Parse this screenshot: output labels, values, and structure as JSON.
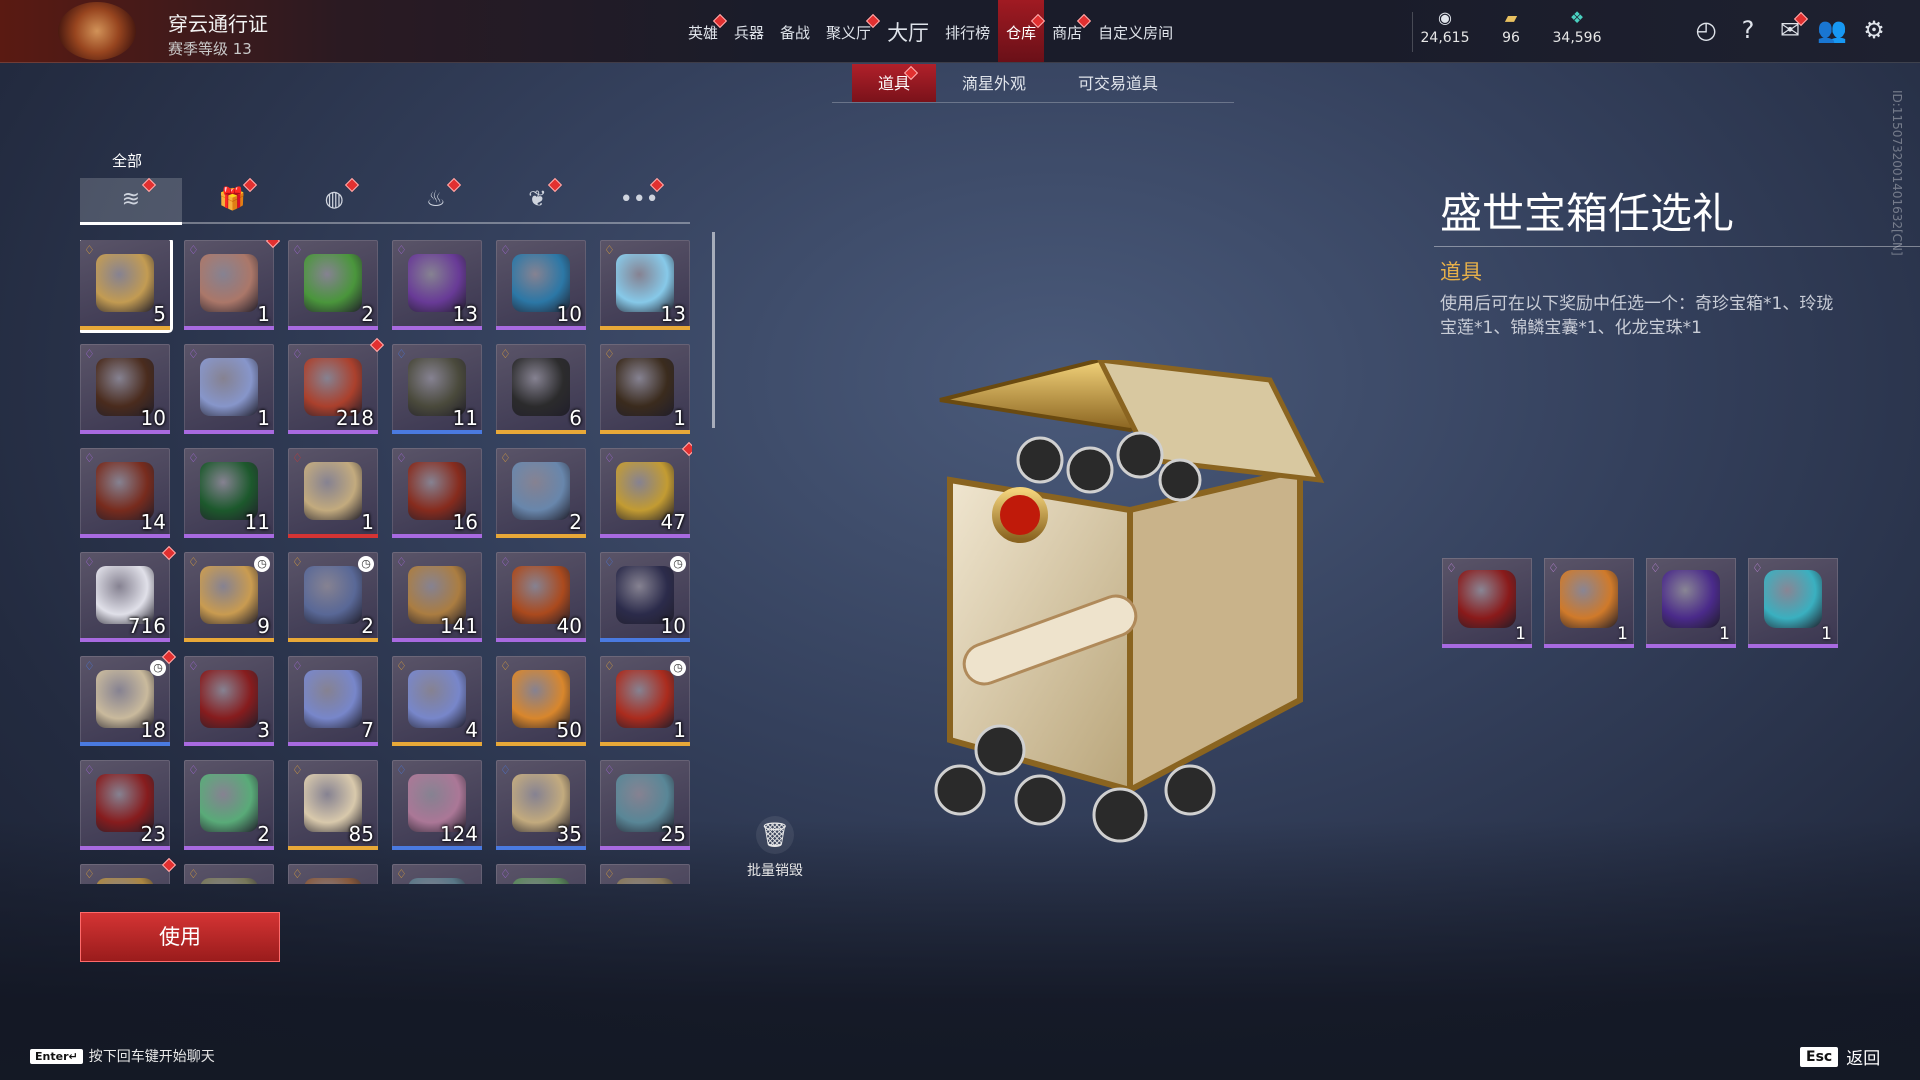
{
  "header": {
    "pass_title": "穿云通行证",
    "pass_level": "赛季等级 13",
    "nav": [
      {
        "label": "英雄",
        "dot": true
      },
      {
        "label": "兵器",
        "dot": false
      },
      {
        "label": "备战",
        "dot": false
      },
      {
        "label": "聚义厅",
        "dot": true
      },
      {
        "label": "大厅",
        "dot": false,
        "big": true
      },
      {
        "label": "排行榜",
        "dot": false
      },
      {
        "label": "仓库",
        "dot": true,
        "active": true
      },
      {
        "label": "商店",
        "dot": true
      },
      {
        "label": "自定义房间",
        "dot": false
      }
    ],
    "currencies": [
      {
        "icon": "mask-coin-icon",
        "value": "24,615"
      },
      {
        "icon": "ticket-icon",
        "value": "96"
      },
      {
        "icon": "feather-gem-icon",
        "value": "34,596"
      }
    ],
    "icons": [
      "timer-icon",
      "help-icon",
      "mail-icon",
      "friends-icon",
      "settings-icon"
    ]
  },
  "subtabs": [
    {
      "label": "道具",
      "active": true,
      "dot": true
    },
    {
      "label": "滴星外观",
      "active": false,
      "dot": false
    },
    {
      "label": "可交易道具",
      "active": false,
      "dot": false
    }
  ],
  "filters": {
    "all_label": "全部",
    "items": [
      {
        "icon": "layers-icon",
        "active": true
      },
      {
        "icon": "gift-icon",
        "active": false
      },
      {
        "icon": "pouch-icon",
        "active": false
      },
      {
        "icon": "flame-icon",
        "active": false
      },
      {
        "icon": "wreath-icon",
        "active": false
      },
      {
        "icon": "more-icon",
        "active": false
      }
    ]
  },
  "colors": {
    "purple": "#a86ae0",
    "gold": "#e8a838",
    "blue": "#4a7ae0",
    "red": "#d43434",
    "accent": "#b0202a"
  },
  "items": [
    {
      "qty": "5",
      "rarity": "gold",
      "art": "#c9a052",
      "selected": true
    },
    {
      "qty": "1",
      "rarity": "purple",
      "art": "#b07a6a",
      "dot": true
    },
    {
      "qty": "2",
      "rarity": "purple",
      "art": "#4a9a3a"
    },
    {
      "qty": "13",
      "rarity": "purple",
      "art": "#6a3a9a"
    },
    {
      "qty": "10",
      "rarity": "purple",
      "art": "#2a7aaa"
    },
    {
      "qty": "13",
      "rarity": "gold",
      "art": "#8ad0f0"
    },
    {
      "qty": "10",
      "rarity": "purple",
      "art": "#4a2a1a"
    },
    {
      "qty": "1",
      "rarity": "purple",
      "art": "#8a9ad0"
    },
    {
      "qty": "218",
      "rarity": "purple",
      "art": "#b0402a",
      "dot": true
    },
    {
      "qty": "11",
      "rarity": "blue",
      "art": "#4a4a3a"
    },
    {
      "qty": "6",
      "rarity": "gold",
      "art": "#2a2a2a"
    },
    {
      "qty": "1",
      "rarity": "gold",
      "art": "#3a2a1a"
    },
    {
      "qty": "14",
      "rarity": "purple",
      "art": "#7a2a1a"
    },
    {
      "qty": "11",
      "rarity": "purple",
      "art": "#1a5a2a"
    },
    {
      "qty": "1",
      "rarity": "red",
      "art": "#c9b080"
    },
    {
      "qty": "16",
      "rarity": "purple",
      "art": "#8a2a1a"
    },
    {
      "qty": "2",
      "rarity": "gold",
      "art": "#6a8ab0"
    },
    {
      "qty": "47",
      "rarity": "purple",
      "art": "#c9a030",
      "dot": true
    },
    {
      "qty": "716",
      "rarity": "purple",
      "art": "#e8e8f0",
      "dot": true
    },
    {
      "qty": "9",
      "rarity": "gold",
      "art": "#d0a050",
      "clock": true
    },
    {
      "qty": "2",
      "rarity": "gold",
      "art": "#5a6a9a",
      "clock": true
    },
    {
      "qty": "141",
      "rarity": "purple",
      "art": "#b08040"
    },
    {
      "qty": "40",
      "rarity": "purple",
      "art": "#b04a1a"
    },
    {
      "qty": "10",
      "rarity": "blue",
      "art": "#2a2a4a",
      "clock": true
    },
    {
      "qty": "18",
      "rarity": "blue",
      "art": "#d0c0a0",
      "clock": true,
      "dot": true
    },
    {
      "qty": "3",
      "rarity": "purple",
      "art": "#8a1a1a"
    },
    {
      "qty": "7",
      "rarity": "purple",
      "art": "#7a8ad0"
    },
    {
      "qty": "4",
      "rarity": "gold",
      "art": "#7a8ad0"
    },
    {
      "qty": "50",
      "rarity": "gold",
      "art": "#e08a2a"
    },
    {
      "qty": "1",
      "rarity": "gold",
      "art": "#b02a1a",
      "clock": true
    },
    {
      "qty": "23",
      "rarity": "purple",
      "art": "#8a1a1a"
    },
    {
      "qty": "2",
      "rarity": "purple",
      "art": "#5ab07a"
    },
    {
      "qty": "85",
      "rarity": "gold",
      "art": "#e0d0b0"
    },
    {
      "qty": "124",
      "rarity": "blue",
      "art": "#b07a9a"
    },
    {
      "qty": "35",
      "rarity": "blue",
      "art": "#c9b080"
    },
    {
      "qty": "25",
      "rarity": "purple",
      "art": "#5a8a9a"
    },
    {
      "qty": "",
      "rarity": "gold",
      "art": "#b08a40",
      "dot": true
    },
    {
      "qty": "",
      "rarity": "gold",
      "art": "#7a7a5a"
    },
    {
      "qty": "",
      "rarity": "gold",
      "art": "#8a5a3a"
    },
    {
      "qty": "",
      "rarity": "gold",
      "art": "#5a7a8a"
    },
    {
      "qty": "",
      "rarity": "purple",
      "art": "#5a8a5a"
    },
    {
      "qty": "",
      "rarity": "gold",
      "art": "#8a7a5a"
    }
  ],
  "actions": {
    "use_label": "使用",
    "destroy_label": "批量销毁"
  },
  "detail": {
    "title": "盛世宝箱任选礼",
    "type": "道具",
    "description": "使用后可在以下奖励中任选一个：奇珍宝箱*1、玲珑宝莲*1、锦鳞宝囊*1、化龙宝珠*1",
    "id_tag": "ID:1150732001401632[CN]",
    "rewards": [
      {
        "qty": "1",
        "art": "#8a1a1a"
      },
      {
        "qty": "1",
        "art": "#d07a2a"
      },
      {
        "qty": "1",
        "art": "#4a2a8a"
      },
      {
        "qty": "1",
        "art": "#3ab0c0"
      }
    ]
  },
  "footer": {
    "enter_key": "Enter↵",
    "chat_hint": "按下回车键开始聊天",
    "esc_key": "Esc",
    "back_label": "返回"
  }
}
